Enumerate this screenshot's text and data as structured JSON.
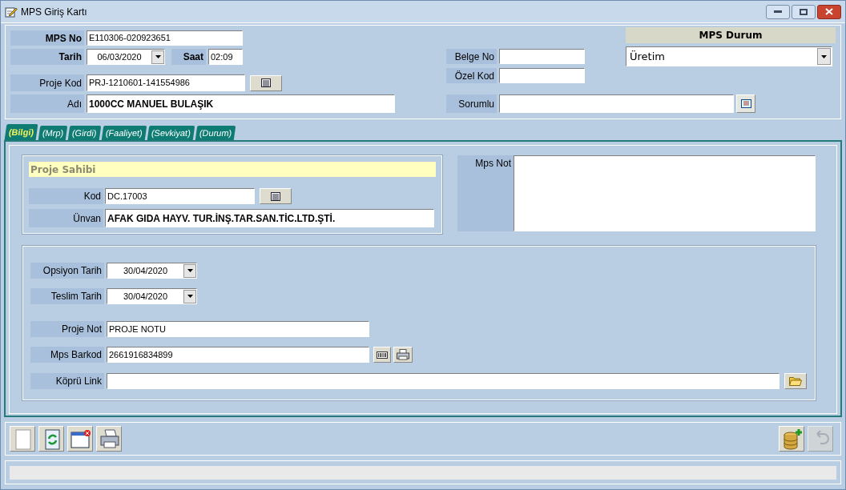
{
  "window": {
    "title": "MPS Giriş Kartı"
  },
  "header": {
    "mps_no": {
      "label": "MPS No",
      "value": "E110306-020923651"
    },
    "tarih": {
      "label": "Tarih",
      "value": "06/03/2020"
    },
    "saat": {
      "label": "Saat",
      "value": "02:09"
    },
    "proje_kod": {
      "label": "Proje Kod",
      "value": "PRJ-1210601-141554986"
    },
    "adi": {
      "label": "Adı",
      "value": "1000CC MANUEL BULAŞIK"
    },
    "belge_no": {
      "label": "Belge No"
    },
    "ozel_kod": {
      "label": "Özel Kod"
    },
    "sorumlu": {
      "label": "Sorumlu"
    },
    "mps_durum": {
      "title": "MPS Durum",
      "value": "Üretim"
    }
  },
  "tabs": [
    {
      "label": "(Bilgi)",
      "selected": true
    },
    {
      "label": "(Mrp)",
      "selected": false
    },
    {
      "label": "(Girdi)",
      "selected": false
    },
    {
      "label": "(Faaliyet)",
      "selected": false
    },
    {
      "label": "(Sevkiyat)",
      "selected": false
    },
    {
      "label": "(Durum)",
      "selected": false
    }
  ],
  "proje_sahibi": {
    "title": "Proje Sahibi",
    "kod": {
      "label": "Kod",
      "value": "DC.17003"
    },
    "unvan": {
      "label": "Ünvan",
      "value": "AFAK GIDA HAYV. TUR.İNŞ.TAR.SAN.TİC.LTD.ŞTİ."
    }
  },
  "mps_not": {
    "label": "Mps Not"
  },
  "details": {
    "opsiyon_tarih": {
      "label": "Opsiyon Tarih",
      "value": "30/04/2020"
    },
    "teslim_tarih": {
      "label": "Teslim Tarih",
      "value": "30/04/2020"
    },
    "proje_not": {
      "label": "Proje Not",
      "value": "PROJE NOTU"
    },
    "mps_barkod": {
      "label": "Mps Barkod",
      "value": "2661916834899"
    },
    "kopru_link": {
      "label": "Köprü Link"
    }
  },
  "toolbar": [
    {
      "kind": "new",
      "disabled": false
    },
    {
      "kind": "refresh",
      "disabled": false
    },
    {
      "kind": "close",
      "disabled": false
    },
    {
      "kind": "print",
      "disabled": false
    },
    {
      "kind": "save",
      "disabled": false
    },
    {
      "kind": "undo",
      "disabled": true
    }
  ]
}
